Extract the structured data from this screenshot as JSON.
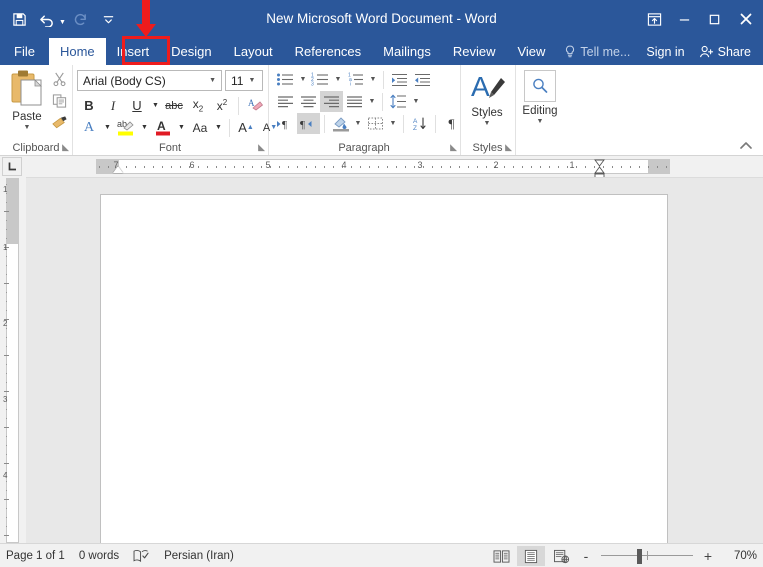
{
  "window": {
    "title": "New Microsoft Word Document - Word",
    "quick_access": [
      {
        "name": "save",
        "label": "Save",
        "icon": "save-icon",
        "enabled": true
      },
      {
        "name": "undo",
        "label": "Undo",
        "icon": "undo-icon",
        "enabled": true
      },
      {
        "name": "redo",
        "label": "Redo",
        "icon": "redo-icon",
        "enabled": false
      },
      {
        "name": "customize",
        "label": "Customize Quick Access Toolbar",
        "icon": "chevron-down-icon",
        "enabled": true
      }
    ],
    "controls": [
      {
        "name": "ribbon-display-options",
        "label": "Ribbon Display Options",
        "icon": "ribbon-options-icon"
      },
      {
        "name": "minimize",
        "label": "Minimize",
        "icon": "minimize-icon"
      },
      {
        "name": "restore",
        "label": "Restore Down",
        "icon": "restore-icon"
      },
      {
        "name": "close",
        "label": "Close",
        "icon": "close-icon"
      }
    ],
    "accent_color": "#2b579a"
  },
  "tabs": {
    "file_label": "File",
    "items": [
      {
        "label": "Home",
        "active": true
      },
      {
        "label": "Insert",
        "active": false,
        "highlighted": true
      },
      {
        "label": "Design",
        "active": false
      },
      {
        "label": "Layout",
        "active": false
      },
      {
        "label": "References",
        "active": false
      },
      {
        "label": "Mailings",
        "active": false
      },
      {
        "label": "Review",
        "active": false
      },
      {
        "label": "View",
        "active": false
      }
    ],
    "tell_me": "Tell me...",
    "sign_in": "Sign in",
    "share": "Share"
  },
  "annotation": {
    "target": "Insert",
    "color": "#ee1c1c",
    "shape": "down-arrow-with-box"
  },
  "ribbon": {
    "collapse_label": "Collapse the Ribbon",
    "groups": [
      {
        "name": "clipboard",
        "label": "Clipboard",
        "has_dialog_launcher": true,
        "paste_label": "Paste",
        "buttons": [
          "cut-icon",
          "copy-icon",
          "format-painter-icon"
        ]
      },
      {
        "name": "font",
        "label": "Font",
        "has_dialog_launcher": true,
        "font_name": "Arial (Body CS)",
        "font_size": "11",
        "row1": [
          "bold",
          "italic",
          "underline",
          "strikethrough",
          "subscript",
          "superscript",
          "clear-formatting"
        ],
        "row2": [
          "text-effects",
          "text-highlight",
          "font-color",
          "change-case",
          "grow-font",
          "shrink-font"
        ]
      },
      {
        "name": "paragraph",
        "label": "Paragraph",
        "has_dialog_launcher": true,
        "row1": [
          "bullets",
          "numbering",
          "multilevel-list",
          "decrease-indent",
          "increase-indent"
        ],
        "row2": [
          "align-left",
          "center",
          "align-right",
          "justify",
          "line-spacing"
        ],
        "row3": [
          "ltr-text-direction",
          "rtl-text-direction",
          "shading",
          "borders",
          "sort",
          "show-formatting-marks"
        ],
        "selected": [
          "align-right",
          "rtl-text-direction"
        ]
      },
      {
        "name": "styles",
        "label": "Styles",
        "has_dialog_launcher": true,
        "button_label": "Styles"
      },
      {
        "name": "editing",
        "label": "",
        "has_dialog_launcher": false,
        "button_label": "Editing"
      }
    ]
  },
  "ruler": {
    "direction": "rtl",
    "horizontal_numbers": [
      "7",
      "6",
      "5",
      "4",
      "3",
      "2",
      "1"
    ],
    "vertical_numbers": [
      "1",
      "1",
      "2",
      "3",
      "4"
    ],
    "tab_selector": "left-tab-stop"
  },
  "document": {
    "page_background": "#ffffff",
    "canvas_background": "#e8e8e8",
    "content": ""
  },
  "status": {
    "page": "Page 1 of 1",
    "words": "0 words",
    "proofing_icon": "proofing-errors-icon",
    "language": "Persian (Iran)",
    "views": [
      {
        "name": "read-mode",
        "label": "Read Mode",
        "selected": false
      },
      {
        "name": "print-layout",
        "label": "Print Layout",
        "selected": true
      },
      {
        "name": "web-layout",
        "label": "Web Layout",
        "selected": false
      }
    ],
    "zoom_out_label": "-",
    "zoom_in_label": "+",
    "zoom_percent": "70%",
    "zoom_value": 70
  }
}
